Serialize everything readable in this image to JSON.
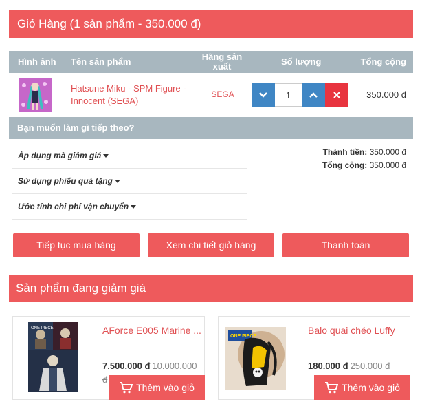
{
  "cart": {
    "header": "Giỏ Hàng (1 sản phẩm - 350.000 đ)",
    "columns": {
      "image": "Hình ảnh",
      "name": "Tên sản phẩm",
      "brand": "Hãng sản xuất",
      "quantity": "Số lượng",
      "total": "Tổng cộng"
    },
    "item": {
      "name": "Hatsune Miku - SPM Figure - Innocent (SEGA)",
      "brand": "SEGA",
      "quantity": "1",
      "total": "350.000 đ"
    },
    "next_title": "Bạn muốn làm gì tiếp theo?",
    "options": [
      "Áp dụng mã giảm giá",
      "Sử dụng phiếu quà tặng",
      "Ước tính chi phí vận chuyển"
    ],
    "summary": {
      "subtotal_label": "Thành tiền:",
      "subtotal_value": "350.000 đ",
      "total_label": "Tổng cộng:",
      "total_value": "350.000 đ"
    },
    "buttons": {
      "continue": "Tiếp tục mua hàng",
      "view": "Xem chi tiết giỏ hàng",
      "checkout": "Thanh toán"
    }
  },
  "sale": {
    "header": "Sản phẩm đang giảm giá",
    "products": [
      {
        "title": "AForce E005 Marine ...",
        "price": "7.500.000 đ",
        "old_price": "10.000.000 đ",
        "add_label": "Thêm vào giỏ"
      },
      {
        "title": "Balo quai chéo Luffy",
        "price": "180.000 đ",
        "old_price": "250.000 đ",
        "add_label": "Thêm vào giỏ"
      }
    ]
  },
  "icons": {
    "qty_down": "chevron-down-icon",
    "qty_up": "chevron-up-icon",
    "remove": "close-icon",
    "caret": "caret-down-icon",
    "cart": "cart-icon"
  },
  "colors": {
    "accent": "#ee5a5c",
    "table_header": "#a8b7bf",
    "link": "#e04f52",
    "qty_button": "#3f86c4",
    "remove_button": "#e8343f"
  }
}
